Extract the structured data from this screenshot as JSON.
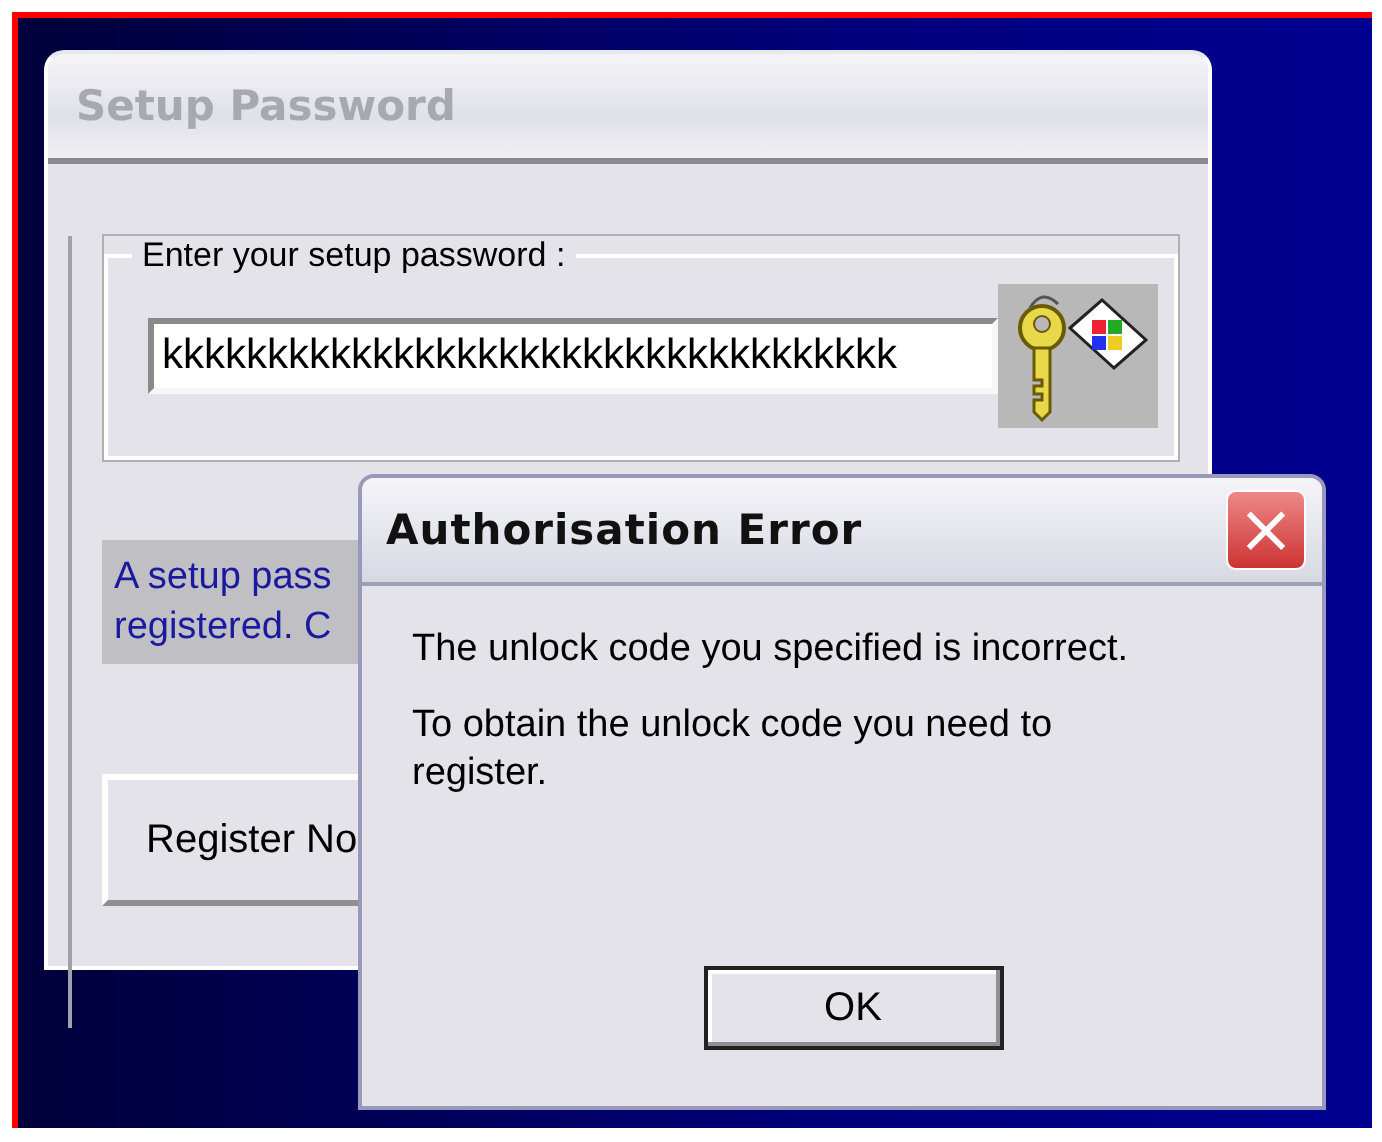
{
  "setup_window": {
    "title": "Setup Password",
    "group_label": "Enter your setup password :",
    "password_field": {
      "value": "kkkkkkkkkkkkkkkkkkkkkkkkkkkkkkkkkkk"
    },
    "info_lines": [
      "A setup pass",
      "registered. C"
    ],
    "buttons": [
      "Register No"
    ]
  },
  "error_dialog": {
    "title": "Authorisation Error",
    "close_button": "×",
    "messages": [
      "The unlock code you specified is incorrect.",
      "To obtain the unlock code you need to register."
    ],
    "buttons": [
      "OK"
    ]
  }
}
